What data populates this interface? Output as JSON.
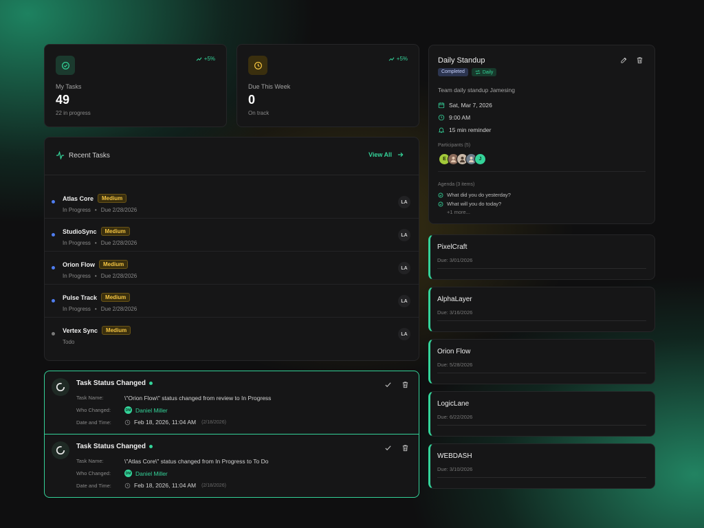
{
  "colors": {
    "accent": "#34d399",
    "medium": "#f5c542",
    "in_progress_dot": "#4f7df0",
    "todo_dot": "#7a7a7a"
  },
  "stats": [
    {
      "label": "My Tasks",
      "value": "49",
      "sub": "22 in progress",
      "trend": "+5%",
      "icon": "check-circle-icon"
    },
    {
      "label": "Due This Week",
      "value": "0",
      "sub": "On track",
      "trend": "+5%",
      "icon": "clock-icon"
    }
  ],
  "recent_tasks": {
    "title": "Recent Tasks",
    "view_all": "View All",
    "items": [
      {
        "name": "Atlas Core",
        "priority": "Medium",
        "status": "In Progress",
        "due": "Due 2/28/2026",
        "assignee": "LA"
      },
      {
        "name": "StudioSync",
        "priority": "Medium",
        "status": "In Progress",
        "due": "Due 2/28/2026",
        "assignee": "LA"
      },
      {
        "name": "Orion Flow",
        "priority": "Medium",
        "status": "In Progress",
        "due": "Due 2/28/2026",
        "assignee": "LA"
      },
      {
        "name": "Pulse Track",
        "priority": "Medium",
        "status": "In Progress",
        "due": "Due 2/28/2026",
        "assignee": "LA"
      },
      {
        "name": "Vertex Sync",
        "priority": "Medium",
        "status": "Todo",
        "due": "",
        "assignee": "LA"
      }
    ]
  },
  "notifications": {
    "labels": {
      "task_name": "Task Name:",
      "who_changed": "Who Changed:",
      "date_time": "Date and Time:"
    },
    "items": [
      {
        "title": "Task Status Changed",
        "task": "\\\"Orion Flow\\\" status changed from review to In Progress",
        "who": "Daniel Miller",
        "who_initials": "DM",
        "datetime": "Feb 18, 2026, 11:04 AM",
        "date_short": "(2/18/2026)"
      },
      {
        "title": "Task Status Changed",
        "task": "\\\"Atlas Core\\\" status changed from In Progress to To Do",
        "who": "Daniel Miller",
        "who_initials": "DM",
        "datetime": "Feb 18, 2026, 11:04 AM",
        "date_short": "(2/18/2026)"
      }
    ]
  },
  "standup": {
    "title": "Daily Standup",
    "status_badge": "Completed",
    "recurrence_badge": "Daily",
    "description": "Team daily standup Jamesing",
    "date": "Sat, Mar 7, 2026",
    "time": "9:00 AM",
    "reminder": "15 min reminder",
    "participants_label": "Participants (5)",
    "participants": [
      {
        "initial": "E",
        "bg": "#a3c93a",
        "fg": "#1f2a07"
      },
      {
        "initial": "",
        "bg": "#8a6a5a",
        "fg": "#ffffff"
      },
      {
        "initial": "",
        "bg": "#c9b8a8",
        "fg": "#ffffff"
      },
      {
        "initial": "",
        "bg": "#6d7b8a",
        "fg": "#ffffff"
      },
      {
        "initial": "J",
        "bg": "#34d399",
        "fg": "#0b3b2a"
      }
    ],
    "agenda_label": "Agenda (3 items)",
    "agenda": [
      "What did you do yesterday?",
      "What will you do today?"
    ],
    "agenda_more": "+1 more..."
  },
  "projects": [
    {
      "name": "PixelCraft",
      "due": "Due: 3/01/2026"
    },
    {
      "name": "AlphaLayer",
      "due": "Due: 3/16/2026"
    },
    {
      "name": "Orion Flow",
      "due": "Due: 5/28/2026"
    },
    {
      "name": "LogicLane",
      "due": "Due: 6/22/2026"
    },
    {
      "name": "WEBDASH",
      "due": "Due: 3/10/2026"
    }
  ]
}
